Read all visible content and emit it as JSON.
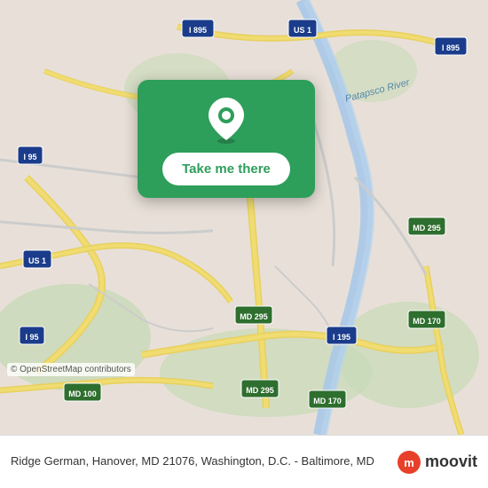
{
  "map": {
    "background_color": "#e8e0d8"
  },
  "card": {
    "background_color": "#2e9e5b",
    "pin_icon": "location-pin",
    "button_label": "Take me there"
  },
  "bottom_bar": {
    "address": "Ridge German, Hanover, MD 21076, Washington, D.C.\n- Baltimore, MD",
    "copyright": "© OpenStreetMap contributors",
    "logo_text": "moovit",
    "logo_dot_color": "#e8402a"
  }
}
